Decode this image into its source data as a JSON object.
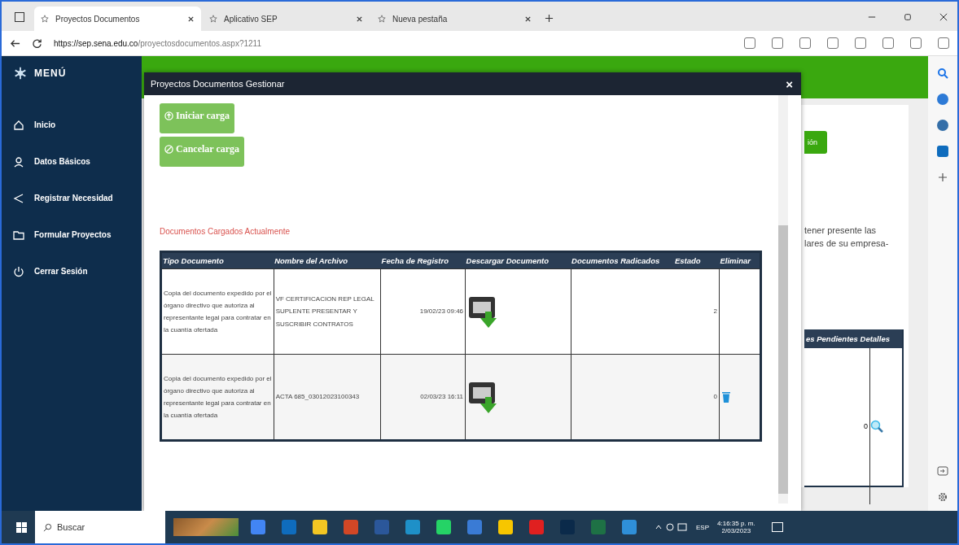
{
  "browser": {
    "tabs": [
      {
        "title": "Proyectos Documentos",
        "selected": true
      },
      {
        "title": "Aplicativo SEP",
        "selected": false
      },
      {
        "title": "Nueva pestaña",
        "selected": false
      }
    ],
    "url_host": "https://sep.sena.edu.co",
    "url_path": "/proyectosdocumentos.aspx?1211"
  },
  "sidebar": {
    "title": "MENÚ",
    "items": [
      {
        "label": "Inicio"
      },
      {
        "label": "Datos Básicos"
      },
      {
        "label": "Registrar Necesidad"
      },
      {
        "label": "Formular Proyectos"
      },
      {
        "label": "Cerrar Sesión"
      }
    ]
  },
  "background_page": {
    "button": "ión",
    "text_lines": [
      "tener presente las",
      "lares de su empresa-"
    ],
    "table_header": "es Pendientes Detalles",
    "cell": "0"
  },
  "modal": {
    "title": "Proyectos Documentos Gestionar",
    "close": "×",
    "buttons": [
      {
        "label": "Iniciar carga",
        "kind": "start"
      },
      {
        "label": "Cancelar carga",
        "kind": "cancel"
      }
    ],
    "section_title": "Documentos Cargados Actualmente",
    "table": {
      "columns": [
        "Tipo Documento",
        "Nombre del Archivo",
        "Fecha de Registro",
        "Descargar Documento",
        "Documentos Radicados",
        "Estado",
        "Eliminar"
      ],
      "rows": [
        {
          "tipo": "Copia del documento expedido por el órgano directivo que autoriza al representante legal para contratar en la cuantía ofertada",
          "archivo": "VF CERTIFICACION REP LEGAL SUPLENTE PRESENTAR Y SUSCRIBIR CONTRATOS",
          "fecha": "19/02/23 09:46",
          "estado": "2",
          "deletable": false
        },
        {
          "tipo": "Copia del documento expedido por el órgano directivo que autoriza al representante legal para contratar en la cuantía ofertada",
          "archivo": "ACTA 685_03012023100343",
          "fecha": "02/03/23 16:11",
          "estado": "0",
          "deletable": true
        }
      ]
    }
  },
  "taskbar": {
    "search_placeholder": "Buscar",
    "language": "ESP",
    "time": "4:16:35 p. m.",
    "date": "2/03/2023"
  }
}
